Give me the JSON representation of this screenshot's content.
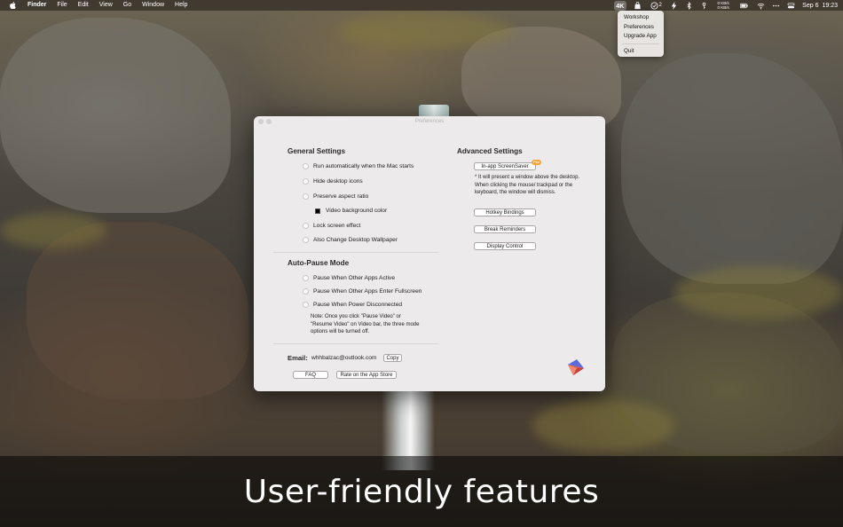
{
  "menubar": {
    "app_name": "Finder",
    "menus": [
      "File",
      "Edit",
      "View",
      "Go",
      "Window",
      "Help"
    ],
    "badge_count": "2",
    "speed_up": "0 KB/s",
    "speed_down": "0 KB/s",
    "date": "Sep 6",
    "time": "19:23"
  },
  "status_menu": {
    "items": [
      "Workshop",
      "Preferences",
      "Upgrade App"
    ],
    "quit": "Quit"
  },
  "window": {
    "title": "Preferences",
    "general": {
      "heading": "General Settings",
      "options": [
        "Run automatically when the Mac starts",
        "Hide desktop icons",
        "Preserve aspect ratio",
        "Video background color",
        "Lock screen effect",
        "Also Change Desktop Wallpaper"
      ],
      "swatch_color": "#000000"
    },
    "auto_pause": {
      "heading": "Auto-Pause Mode",
      "options": [
        "Pause When Other Apps Active",
        "Pause When Other Apps Enter Fullscreen",
        "Pause When Power Disconnected"
      ],
      "note": "Note: Once you click \"Pause Video\" or \"Resume Video\" on Video bar, the three mode options will be turned off."
    },
    "advanced": {
      "heading": "Advanced Settings",
      "screensaver_button": "In-app ScreenSaver",
      "pro_badge": "Pro",
      "screensaver_note": "* It will present a window above the desktop. When clicking the mouse/ trackpad or the keyboard, the window will dismiss.",
      "buttons": [
        "Hotkey Bindings",
        "Break Reminders",
        "Display Control"
      ]
    },
    "contact": {
      "email_label": "Email:",
      "email": "whhbalzac@outlook.com",
      "copy_button": "Copy",
      "faq_button": "FAQ",
      "rate_button": "Rate on the App Store"
    }
  },
  "caption": "User-friendly features"
}
